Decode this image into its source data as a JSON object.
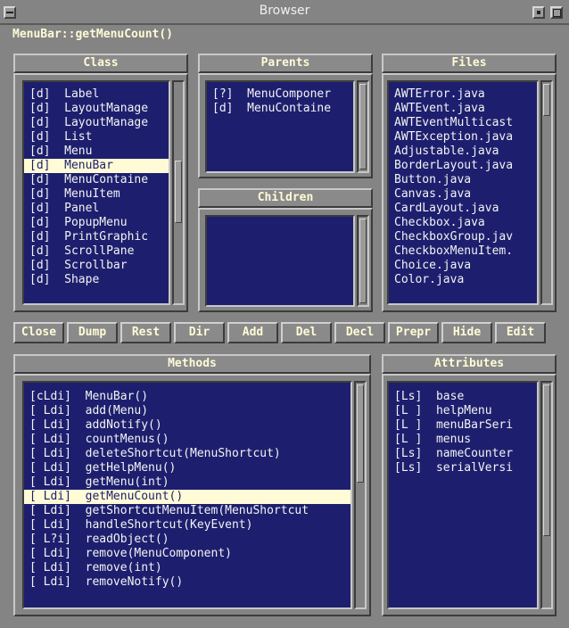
{
  "window": {
    "title": "Browser"
  },
  "location": "MenuBar::getMenuCount()",
  "class_panel": {
    "header": "Class",
    "items": [
      "[d]  Label",
      "[d]  LayoutManage",
      "[d]  LayoutManage",
      "[d]  List",
      "[d]  Menu",
      "[d]  MenuBar",
      "[d]  MenuContaine",
      "[d]  MenuItem",
      "[d]  Panel",
      "[d]  PopupMenu",
      "[d]  PrintGraphic",
      "[d]  ScrollPane",
      "[d]  Scrollbar",
      "[d]  Shape"
    ],
    "selected": "[d]  MenuBar"
  },
  "parents_panel": {
    "header": "Parents",
    "items": [
      "[?]  MenuComponer",
      "[d]  MenuContaine"
    ]
  },
  "children_panel": {
    "header": "Children",
    "items": []
  },
  "files_panel": {
    "header": "Files",
    "items": [
      "AWTError.java",
      "AWTEvent.java",
      "AWTEventMulticast",
      "AWTException.java",
      "Adjustable.java",
      "BorderLayout.java",
      "Button.java",
      "Canvas.java",
      "CardLayout.java",
      "Checkbox.java",
      "CheckboxGroup.jav",
      "CheckboxMenuItem.",
      "Choice.java",
      "Color.java"
    ]
  },
  "toolbar": {
    "buttons": [
      "Close",
      "Dump",
      "Rest",
      "Dir",
      "Add",
      "Del",
      "Decl",
      "Prepr",
      "Hide",
      "Edit"
    ]
  },
  "methods_panel": {
    "header": "Methods",
    "items": [
      "[cLdi]  MenuBar()",
      "[ Ldi]  add(Menu)",
      "[ Ldi]  addNotify()",
      "[ Ldi]  countMenus()",
      "[ Ldi]  deleteShortcut(MenuShortcut)",
      "[ Ldi]  getHelpMenu()",
      "[ Ldi]  getMenu(int)",
      "[ Ldi]  getMenuCount()",
      "[ Ldi]  getShortcutMenuItem(MenuShortcut",
      "[ Ldi]  handleShortcut(KeyEvent)",
      "[ L?i]  readObject()",
      "[ Ldi]  remove(MenuComponent)",
      "[ Ldi]  remove(int)",
      "[ Ldi]  removeNotify()"
    ],
    "selected": "[ Ldi]  getMenuCount()"
  },
  "attributes_panel": {
    "header": "Attributes",
    "items": [
      "[Ls]  base",
      "[L ]  helpMenu",
      "[L ]  menuBarSeri",
      "[L ]  menus",
      "[Ls]  nameCounter",
      "[Ls]  serialVersi"
    ]
  },
  "colors": {
    "background": "#848484",
    "list_background": "#1d1f6e",
    "list_text": "#f3f3f3",
    "label_text": "#fffbd6",
    "selection": "#fffbd6"
  }
}
